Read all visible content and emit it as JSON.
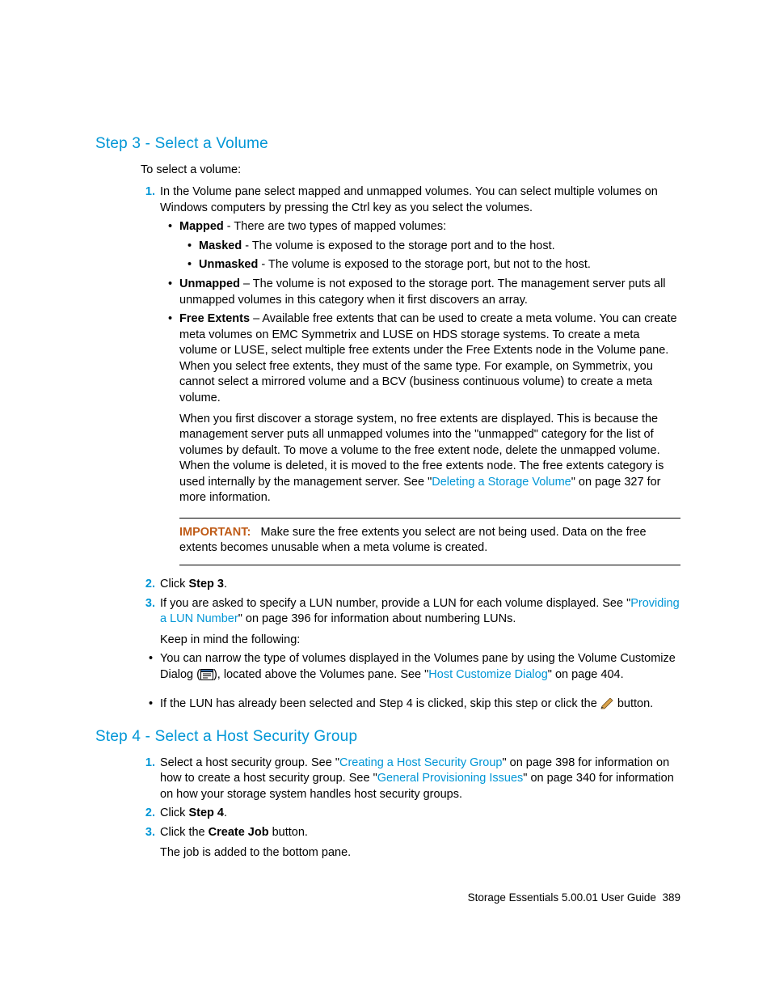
{
  "step3": {
    "heading": "Step 3 - Select a Volume",
    "intro": "To select a volume:",
    "item1": "In the Volume pane select mapped and unmapped volumes. You can select multiple volumes on Windows computers by pressing the Ctrl key as you select the volumes.",
    "mapped_label": "Mapped",
    "mapped_text": " - There are two types of mapped volumes:",
    "masked_label": "Masked",
    "masked_text": " - The volume is exposed to the storage port and to the host.",
    "unmasked_label": "Unmasked",
    "unmasked_text": " - The volume is exposed to the storage port, but not to the host.",
    "unmapped_label": "Unmapped",
    "unmapped_text": " – The volume is not exposed to the storage port. The management server puts all unmapped volumes in this category when it first discovers an array.",
    "free_label": "Free Extents",
    "free_text": " – Available free extents that can be used to create a meta volume. You can create meta volumes on EMC Symmetrix and LUSE on HDS storage systems. To create a meta volume or LUSE, select multiple free extents under the Free Extents node in the Volume pane. When you select free extents, they must of the same type. For example, on Symmetrix, you cannot select a mirrored volume and a BCV (business continuous volume) to create a meta volume.",
    "free_para2_a": "When you first discover a storage system, no free extents are displayed. This is because the management server puts all unmapped volumes into the \"unmapped\" category for the list of volumes by default. To move a volume to the free extent node, delete the unmapped volume. When the volume is deleted, it is moved to the free extents node. The free extents category is used internally by the management server. See \"",
    "link_del": "Deleting a Storage Volume",
    "free_para2_b": "\" on page 327 for more information.",
    "important_label": "IMPORTANT:",
    "important_text": "Make sure the free extents you select are not being used. Data on the free extents becomes unusable when a meta volume is created.",
    "item2_a": "Click ",
    "item2_b": "Step 3",
    "item2_c": ".",
    "item3_a": "If you are asked to specify a LUN number, provide a LUN for each volume displayed. See \"",
    "link_lun": "Providing a LUN Number",
    "item3_b": "\" on page 396 for information about numbering LUNs.",
    "item3_keep": "Keep in mind the following:",
    "narrow_a": "You can narrow the type of volumes displayed in the Volumes pane by using the Volume Customize Dialog (",
    "narrow_b": "), located above the Volumes pane. See \"",
    "link_host_custom": "Host Customize Dialog",
    "narrow_c": "\" on page 404.",
    "lun_sel_a": "If the LUN has already been selected and Step 4 is clicked, skip this step or click the ",
    "lun_sel_b": " button."
  },
  "step4": {
    "heading": "Step 4 - Select a Host Security Group",
    "item1_a": "Select a host security group. See \"",
    "link_create_hsg": "Creating a Host Security Group",
    "item1_b": "\" on page 398 for information on how to create a host security group. See \"",
    "link_gen_prov": "General Provisioning Issues",
    "item1_c": "\" on page 340 for information on how your storage system handles host security groups.",
    "item2_a": "Click ",
    "item2_b": "Step 4",
    "item2_c": ".",
    "item3_a": "Click the ",
    "item3_b": "Create Job",
    "item3_c": " button.",
    "item3_para": "The job is added to the bottom pane."
  },
  "footer": {
    "text": "Storage Essentials 5.00.01 User Guide",
    "page": "389"
  }
}
